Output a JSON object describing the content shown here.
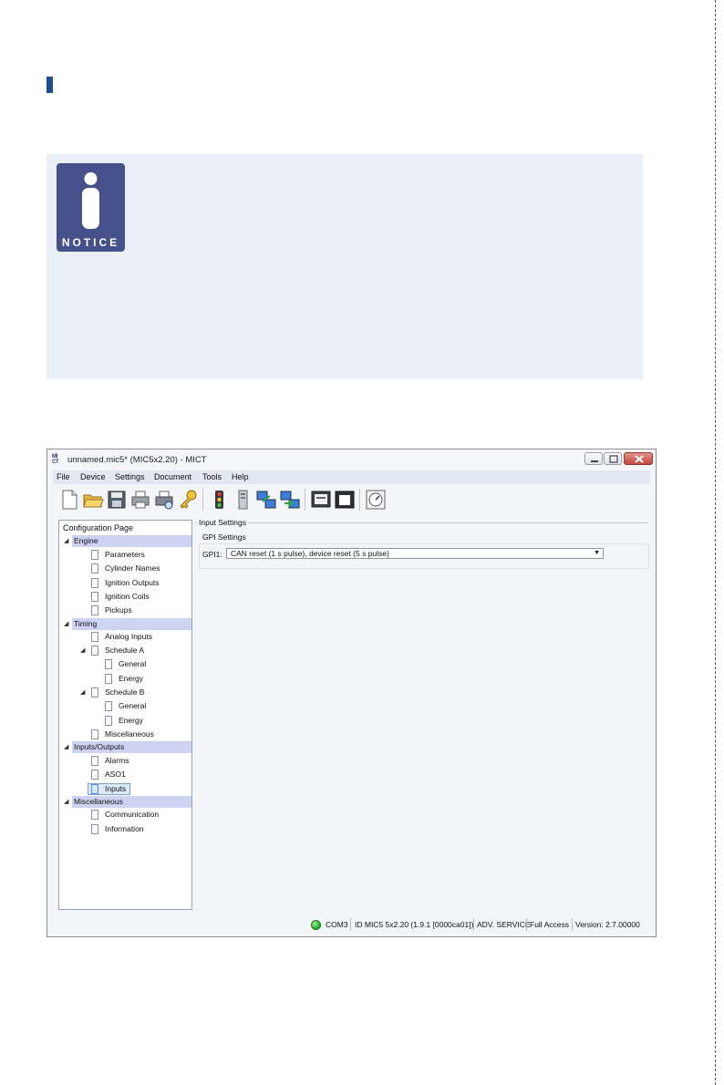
{
  "notice": {
    "icon_letter": "i",
    "label": "NOTICE"
  },
  "window": {
    "logo_text": "MI CT",
    "title": "unnamed.mic5* (MIC5x2.20) - MICT"
  },
  "menu": [
    "File",
    "Device",
    "Settings",
    "Document",
    "Tools",
    "Help"
  ],
  "toolbar": {
    "buttons": [
      "new-document",
      "open-folder",
      "save-disk",
      "print",
      "print-preview",
      "key",
      "traffic-light",
      "tower-device",
      "connect-computers",
      "transfer-computers",
      "monitor",
      "window-frame",
      "gauge"
    ]
  },
  "tree": {
    "header": "Configuration Page",
    "engine": {
      "label": "Engine",
      "items": [
        "Parameters",
        "Cylinder Names",
        "Ignition Outputs",
        "Ignition Coils",
        "Pickups"
      ]
    },
    "timing": {
      "label": "Timing",
      "analog_inputs": "Analog Inputs",
      "schedule_a": {
        "label": "Schedule A",
        "items": [
          "General",
          "Energy"
        ]
      },
      "schedule_b": {
        "label": "Schedule B",
        "items": [
          "General",
          "Energy"
        ]
      },
      "miscellaneous": "Miscellaneous"
    },
    "io": {
      "label": "Inputs/Outputs",
      "items": [
        "Alarms",
        "ASO1",
        "Inputs"
      ],
      "selected": "Inputs"
    },
    "misc": {
      "label": "Miscellaneous",
      "items": [
        "Communication",
        "Information"
      ]
    }
  },
  "content": {
    "group_title": "Input Settings",
    "gpi_title": "GPI Settings",
    "gpi1_label": "GPI1:",
    "gpi1_value": "CAN reset (1 s pulse), device reset (5 s pulse)"
  },
  "status": {
    "led_color": "#22aa22",
    "port": "COM3",
    "device_id": "ID MIC5 5x2.20 (1.9.1 [0000ca01])",
    "mode": "ADV. SERVICE",
    "access": "Full Access",
    "version": "Version: 2.7.00000"
  }
}
